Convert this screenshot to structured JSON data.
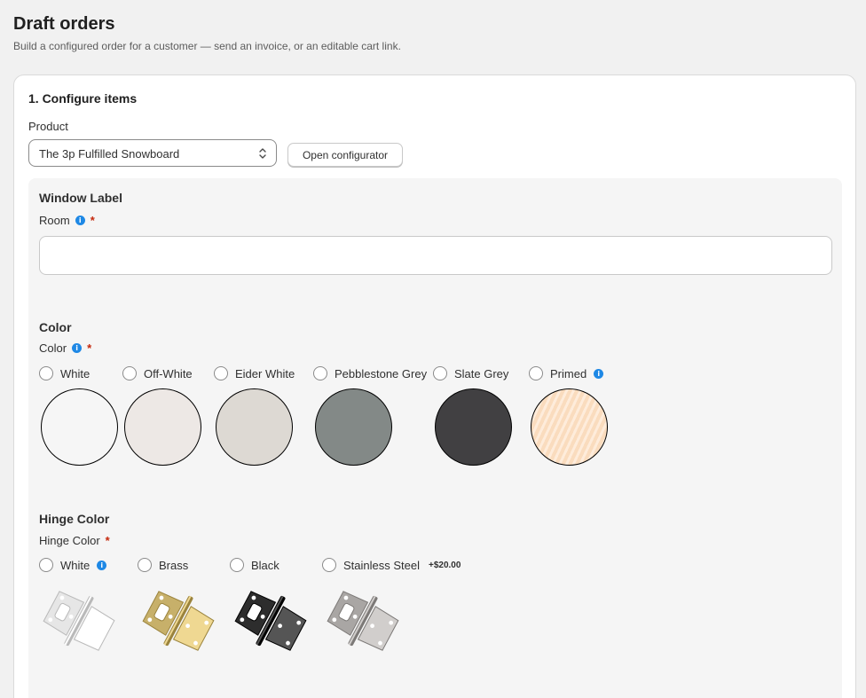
{
  "page": {
    "title": "Draft orders",
    "subtitle": "Build a configured order for a customer — send an invoice, or an editable cart link."
  },
  "configure": {
    "title": "1. Configure items",
    "product_label": "Product",
    "product_value": "The 3p Fulfilled Snowboard",
    "open_configurator": "Open configurator"
  },
  "window_label": {
    "section_title": "Window Label",
    "field_label": "Room",
    "required_mark": "*",
    "value": ""
  },
  "color": {
    "section_title": "Color",
    "field_label": "Color",
    "required_mark": "*",
    "options": [
      {
        "label": "White",
        "swatch": "#f6f6f6"
      },
      {
        "label": "Off-White",
        "swatch": "#ede8e5"
      },
      {
        "label": "Eider White",
        "swatch": "#ddd9d3"
      },
      {
        "label": "Pebblestone Grey",
        "swatch": "#838987"
      },
      {
        "label": "Slate Grey",
        "swatch": "#414042"
      },
      {
        "label": "Primed",
        "swatch": "#fde2c8"
      }
    ]
  },
  "hinge_color": {
    "section_title": "Hinge Color",
    "field_label": "Hinge Color",
    "required_mark": "*",
    "options": [
      {
        "label": "White",
        "icon": "white-hinge-icon",
        "color": "#e6e6e6"
      },
      {
        "label": "Brass",
        "icon": "brass-hinge-icon",
        "color": "#c7b06a"
      },
      {
        "label": "Black",
        "icon": "black-hinge-icon",
        "color": "#2d2d2d"
      },
      {
        "label": "Stainless Steel",
        "price": "+$20.00",
        "icon": "stainless-steel-hinge-icon",
        "color": "#a9a6a4"
      }
    ]
  },
  "colors": {
    "accent": "#1e88e5",
    "required": "#c5280c"
  }
}
